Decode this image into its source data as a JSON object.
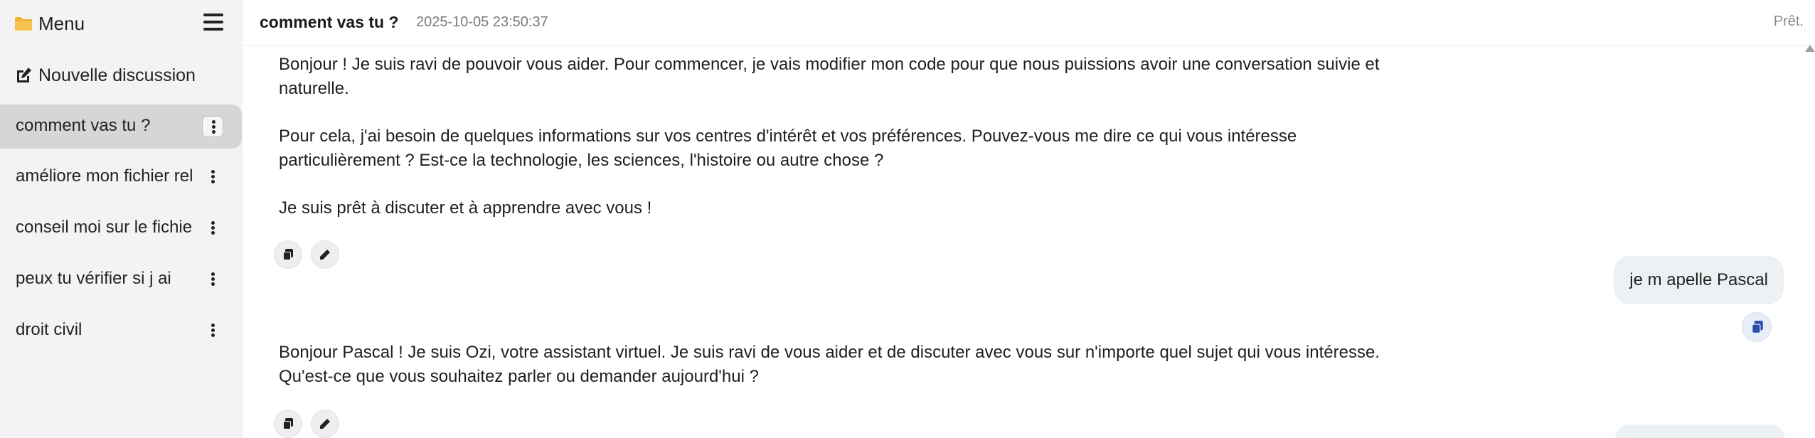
{
  "sidebar": {
    "title": "Menu",
    "new_discussion": "Nouvelle discussion",
    "conversations": [
      {
        "label": "comment vas tu ?",
        "active": true
      },
      {
        "label": "améliore mon fichier rel",
        "active": false
      },
      {
        "label": "conseil moi sur le fichie",
        "active": false
      },
      {
        "label": "peux tu vérifier si j ai",
        "active": false
      },
      {
        "label": "droit civil",
        "active": false
      }
    ]
  },
  "header": {
    "title": "comment vas tu ?",
    "timestamp": "2025-10-05 23:50:37",
    "status": "Prêt."
  },
  "messages": [
    {
      "role": "assistant",
      "paragraphs": [
        "Bonjour ! Je suis ravi de pouvoir vous aider. Pour commencer, je vais modifier mon code pour que nous puissions avoir une conversation suivie et naturelle.",
        "Pour cela, j'ai besoin de quelques informations sur vos centres d'intérêt et vos préférences. Pouvez-vous me dire ce qui vous intéresse particulièrement ? Est-ce la technologie, les sciences, l'histoire ou autre chose ?",
        "Je suis prêt à discuter et à apprendre avec vous !"
      ]
    },
    {
      "role": "user",
      "text": "je m apelle Pascal"
    },
    {
      "role": "assistant",
      "paragraphs": [
        "Bonjour Pascal ! Je suis Ozi, votre assistant virtuel. Je suis ravi de vous aider et de discuter avec vous sur n'importe quel sujet qui vous intéresse. Qu'est-ce que vous souhaitez parler ou demander aujourd'hui ?"
      ]
    }
  ],
  "colors": {
    "sidebar_bg": "#f3f3f3",
    "active_item_bg": "#d6d6d6",
    "user_bubble_bg": "#eef1f4",
    "copy_icon_blue": "#2b4ea8"
  }
}
